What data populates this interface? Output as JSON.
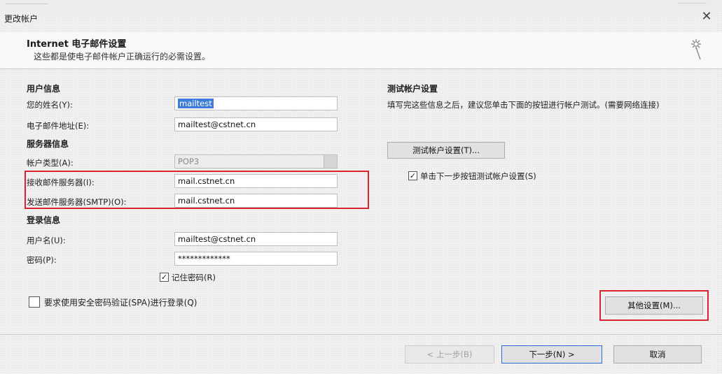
{
  "window": {
    "title": "更改帐户",
    "close_glyph": "✕"
  },
  "header": {
    "title": "Internet 电子邮件设置",
    "subtitle": "这些都是使电子邮件帐户正确运行的必需设置。"
  },
  "user_info": {
    "heading": "用户信息",
    "name_label": "您的姓名(Y):",
    "name_value": "mailtest",
    "email_label": "电子邮件地址(E):",
    "email_value": "mailtest@cstnet.cn"
  },
  "server_info": {
    "heading": "服务器信息",
    "account_type_label": "帐户类型(A):",
    "account_type_value": "POP3",
    "incoming_label": "接收邮件服务器(I):",
    "incoming_value": "mail.cstnet.cn",
    "outgoing_label": "发送邮件服务器(SMTP)(O):",
    "outgoing_value": "mail.cstnet.cn"
  },
  "logon_info": {
    "heading": "登录信息",
    "username_label": "用户名(U):",
    "username_value": "mailtest@cstnet.cn",
    "password_label": "密码(P):",
    "password_value": "*************",
    "remember_label": "记住密码(R)",
    "remember_checked": true,
    "spa_label": "要求使用安全密码验证(SPA)进行登录(Q)",
    "spa_checked": false
  },
  "test_settings": {
    "heading": "测试帐户设置",
    "description": "填写完这些信息之后，建议您单击下面的按钮进行帐户测试。(需要网络连接)",
    "test_button": "测试帐户设置(T)...",
    "auto_test_label": "单击下一步按钮测试帐户设置(S)",
    "auto_test_checked": true,
    "more_settings_button": "其他设置(M)..."
  },
  "footer": {
    "back_button": "< 上一步(B)",
    "next_button": "下一步(N) >",
    "cancel_button": "取消"
  },
  "colors": {
    "highlight_box": "#d9232e",
    "selection": "#3d7bd8"
  },
  "icons": {
    "wizard": "wizard-sparkle-icon",
    "dropdown": "dropdown-arrow-icon",
    "close": "close-icon",
    "check": "checkmark-icon"
  }
}
